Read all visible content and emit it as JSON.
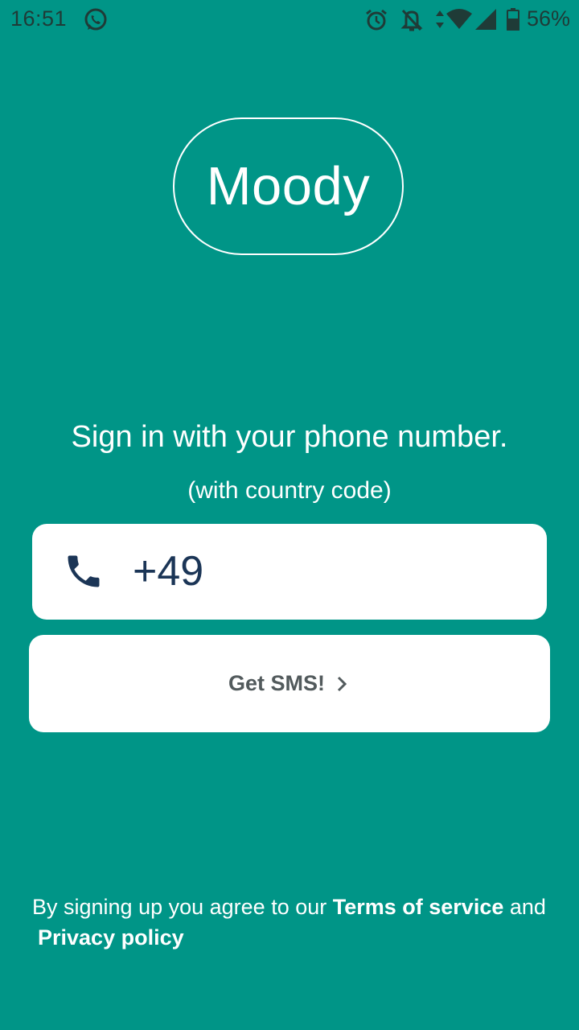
{
  "status_bar": {
    "time": "16:51",
    "battery": "56%",
    "icons": [
      "whatsapp-icon",
      "alarm-icon",
      "bell-off-icon",
      "data-arrows-icon",
      "wifi-icon",
      "signal-icon",
      "battery-icon"
    ]
  },
  "logo": {
    "text": "Moody"
  },
  "heading": "Sign in with your phone number.",
  "subheading": "(with country code)",
  "phone_field": {
    "value": "+49",
    "icon": "phone-icon"
  },
  "sms_button": {
    "label": "Get SMS!",
    "icon": "chevron-right-icon"
  },
  "legal": {
    "prefix": "By signing up you agree to our ",
    "terms": "Terms of service",
    "and": " and",
    "privacy": "Privacy policy"
  },
  "colors": {
    "background": "#009587",
    "text": "#ffffff",
    "input_text": "#1b3556",
    "button_text": "#525a5c",
    "status_icons": "#1f3b37"
  }
}
